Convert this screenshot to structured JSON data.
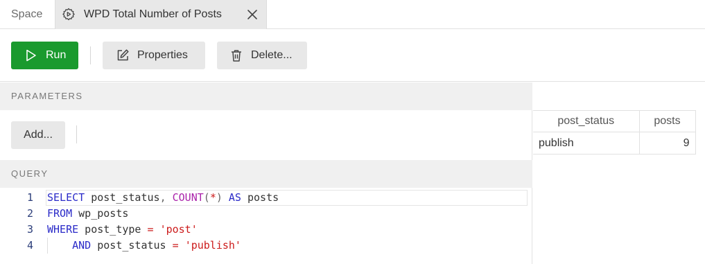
{
  "tabs": {
    "space_label": "Space",
    "active_title": "WPD Total Number of Posts",
    "active_icon": "gear-icon",
    "close_icon": "close-icon"
  },
  "toolbar": {
    "run_label": "Run",
    "properties_label": "Properties",
    "delete_label": "Delete...",
    "run_color": "#1a9a2e"
  },
  "parameters": {
    "heading": "PARAMETERS",
    "add_label": "Add..."
  },
  "query": {
    "heading": "QUERY",
    "lines": [
      {
        "num": "1",
        "current": true,
        "tokens": [
          {
            "t": "SELECT",
            "c": "kw"
          },
          {
            "t": " post_status",
            "c": ""
          },
          {
            "t": ",",
            "c": "pn"
          },
          {
            "t": " ",
            "c": ""
          },
          {
            "t": "COUNT",
            "c": "fn"
          },
          {
            "t": "(",
            "c": "pn"
          },
          {
            "t": "*",
            "c": "op"
          },
          {
            "t": ")",
            "c": "pn"
          },
          {
            "t": " ",
            "c": ""
          },
          {
            "t": "AS",
            "c": "kw"
          },
          {
            "t": " posts",
            "c": ""
          }
        ]
      },
      {
        "num": "2",
        "current": false,
        "tokens": [
          {
            "t": "FROM",
            "c": "kw"
          },
          {
            "t": " wp_posts",
            "c": ""
          }
        ]
      },
      {
        "num": "3",
        "current": false,
        "tokens": [
          {
            "t": "WHERE",
            "c": "kw"
          },
          {
            "t": " post_type ",
            "c": ""
          },
          {
            "t": "=",
            "c": "op"
          },
          {
            "t": " ",
            "c": ""
          },
          {
            "t": "'post'",
            "c": "str"
          }
        ]
      },
      {
        "num": "4",
        "current": false,
        "indent": true,
        "tokens": [
          {
            "t": "    ",
            "c": ""
          },
          {
            "t": "AND",
            "c": "kw"
          },
          {
            "t": " post_status ",
            "c": ""
          },
          {
            "t": "=",
            "c": "op"
          },
          {
            "t": " ",
            "c": ""
          },
          {
            "t": "'publish'",
            "c": "str"
          }
        ]
      }
    ]
  },
  "results": {
    "columns": [
      "post_status",
      "posts"
    ],
    "rows": [
      [
        "publish",
        "9"
      ]
    ]
  }
}
